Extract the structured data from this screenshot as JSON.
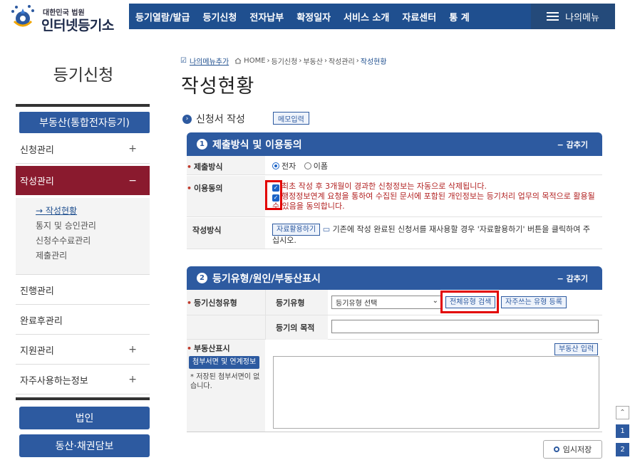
{
  "header": {
    "logo_sub": "대한민국 법원",
    "logo_main": "인터넷등기소",
    "menu": [
      "등기열람/발급",
      "등기신청",
      "전자납부",
      "확정일자",
      "서비스 소개",
      "자료센터",
      "통 계"
    ],
    "my_menu": "나의메뉴"
  },
  "sidebar": {
    "title": "등기신청",
    "section": "부동산(통합전자등기)",
    "items": [
      {
        "label": "신청관리",
        "sign": "+"
      },
      {
        "label": "작성관리",
        "sign": "−"
      },
      {
        "label": "진행관리",
        "sign": ""
      },
      {
        "label": "완료후관리",
        "sign": ""
      },
      {
        "label": "지원관리",
        "sign": "+"
      },
      {
        "label": "자주사용하는정보",
        "sign": "+"
      }
    ],
    "subitems": [
      "작성현황",
      "통지 및 승인관리",
      "신청수수료관리",
      "제출관리"
    ],
    "bottom_buttons": [
      "법인",
      "동산·채권담보"
    ]
  },
  "breadcrumb": {
    "favorite": "나의메뉴추가",
    "path": [
      "HOME",
      "등기신청",
      "부동산",
      "작성관리",
      "작성현황"
    ]
  },
  "page_title": "작성현황",
  "section_title": "신청서 작성",
  "memo_button": "메모입력",
  "panel1": {
    "num": "1",
    "title": "제출방식 및 이용동의",
    "toggle": "− 감추기",
    "submit_label": "제출방식",
    "submit_options": [
      "전자",
      "이폼"
    ],
    "consent_label": "이용동의",
    "consent1": "최초 작성 후 3개월이 경과한 신청정보는 자동으로 삭제됩니다.",
    "consent2": "행정정보연계 요청을 통하여 수집된 문서에 포함된 개인정보는 등기처리 업무의 목적으로 활용될 수 있음을 동의합니다.",
    "method_label": "작성방식",
    "method_button": "자료활용하기",
    "method_text": "기존에 작성 완료된 신청서를 재사용할 경우 '자료활용하기' 버튼을 클릭하여 주십시오."
  },
  "panel2": {
    "num": "2",
    "title": "등기유형/원인/부동산표시",
    "toggle": "− 감추기",
    "type_label": "등기신청유형",
    "type_sub": "등기유형",
    "type_select": "등기유형 선택",
    "search_button": "전체유형 검색",
    "register_button": "자주쓰는 유형 등록",
    "purpose_label": "등기의 목적",
    "realestate_label": "부동산표시",
    "attach_button": "첨부서면 및 연계정보",
    "attach_note": "저장된 첨부서면이 없습니다.",
    "input_button": "부동산 입력"
  },
  "save_button": "임시저장",
  "pager": [
    "1",
    "2"
  ]
}
